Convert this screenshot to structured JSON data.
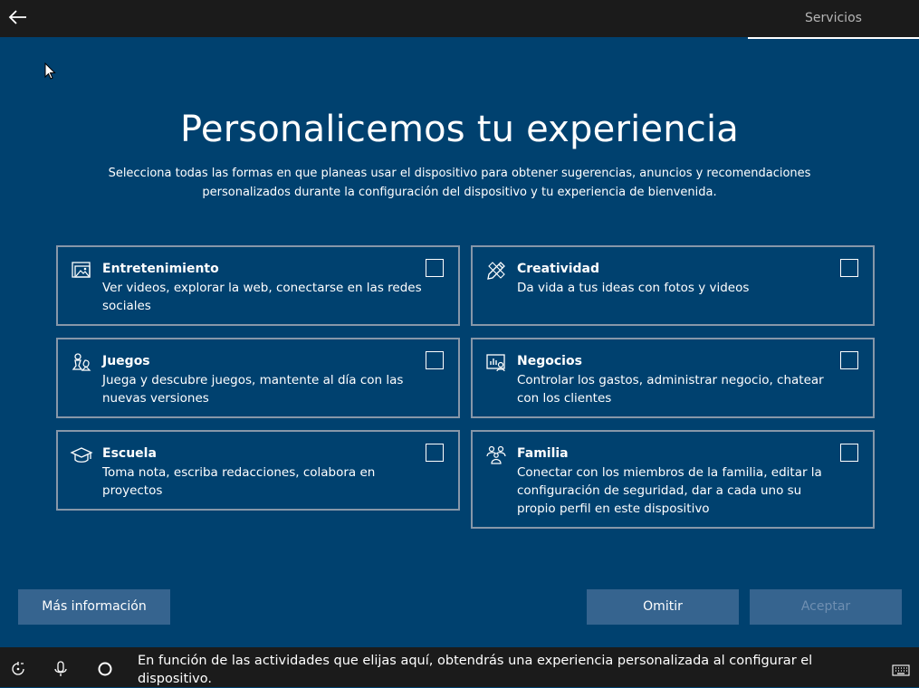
{
  "header": {
    "step_label": "Servicios",
    "back_icon": "arrow-left-icon"
  },
  "main": {
    "title": "Personalicemos tu experiencia",
    "subtitle_line1": "Selecciona todas las formas en que planeas usar el dispositivo para obtener sugerencias, anuncios y recomendaciones",
    "subtitle_line2": "personalizados durante la configuración del dispositivo y tu experiencia de bienvenida."
  },
  "cards": [
    {
      "title": "Entretenimiento",
      "desc1": "Ver videos, explorar la web, conectarse en las redes",
      "desc2": "sociales",
      "desc3": "",
      "icon": "media-icon",
      "checked": false
    },
    {
      "title": "Creatividad",
      "desc1": "Da vida a tus ideas con fotos y videos",
      "desc2": "",
      "desc3": "",
      "icon": "pen-ruler-icon",
      "checked": false
    },
    {
      "title": "Juegos",
      "desc1": "Juega y descubre juegos, mantente al día con las",
      "desc2": "nuevas versiones",
      "desc3": "",
      "icon": "game-pieces-icon",
      "checked": false
    },
    {
      "title": "Negocios",
      "desc1": "Controlar los gastos, administrar negocio, chatear",
      "desc2": "con los clientes",
      "desc3": "",
      "icon": "business-chart-icon",
      "checked": false
    },
    {
      "title": "Escuela",
      "desc1": "Toma nota, escriba redacciones, colabora en",
      "desc2": "proyectos",
      "desc3": "",
      "icon": "graduation-cap-icon",
      "checked": false
    },
    {
      "title": "Familia",
      "desc1": "Conectar con los miembros de la familia, editar la",
      "desc2": "configuración de seguridad, dar a cada uno su",
      "desc3": "propio perfil en este dispositivo",
      "icon": "family-icon",
      "checked": false
    }
  ],
  "buttons": {
    "more_info": "Más información",
    "skip": "Omitir",
    "accept": "Aceptar"
  },
  "footer": {
    "caption_line1": "En función de las actividades que elijas aquí, obtendrás una experiencia personalizada al configurar el",
    "caption_line2": "dispositivo.",
    "icons": [
      "accessibility-icon",
      "microphone-icon",
      "cortana-icon",
      "keyboard-icon"
    ]
  },
  "colors": {
    "background": "#00416f",
    "bar": "#1b1b1b",
    "button": "#36648f",
    "card_border": "#8797a9"
  }
}
